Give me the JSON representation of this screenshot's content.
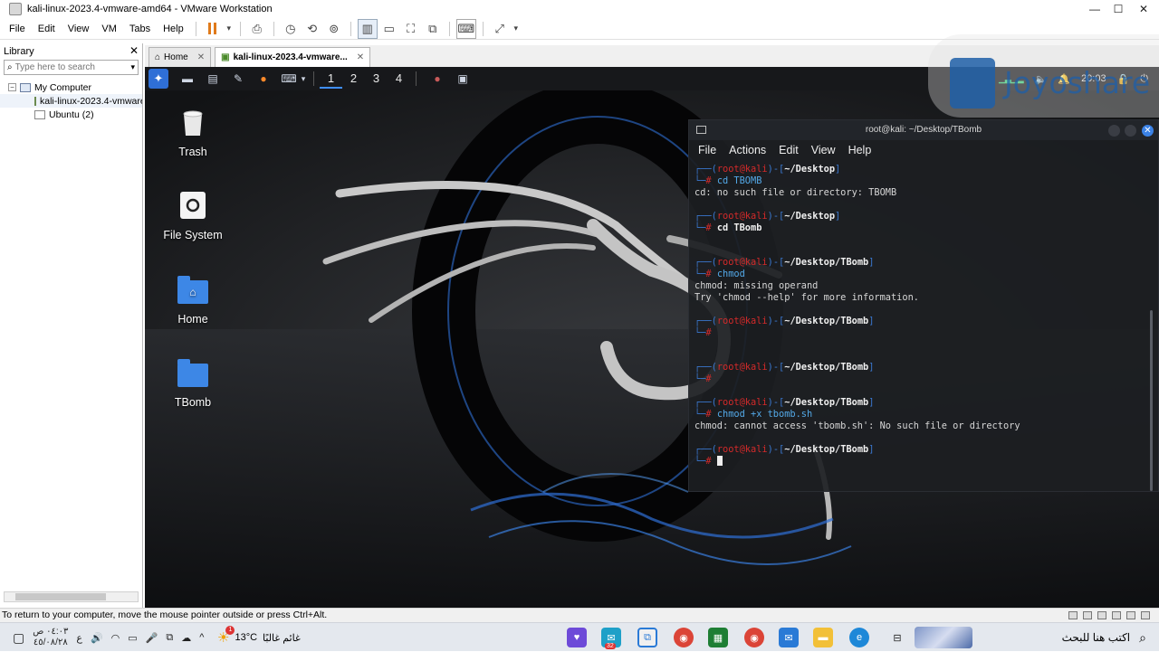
{
  "window": {
    "title": "kali-linux-2023.4-vmware-amd64 - VMware Workstation",
    "minimize_glyph": "—",
    "maximize_glyph": "☐",
    "close_glyph": "✕"
  },
  "menubar": {
    "items": [
      "File",
      "Edit",
      "View",
      "VM",
      "Tabs",
      "Help"
    ]
  },
  "library": {
    "title": "Library",
    "close_glyph": "✕",
    "search_placeholder": "Type here to search",
    "dropdown_glyph": "▾",
    "tree": {
      "root": "My Computer",
      "children": [
        "kali-linux-2023.4-vmware",
        "Ubuntu (2)"
      ]
    }
  },
  "tabs": [
    {
      "label": "Home",
      "active": false
    },
    {
      "label": "kali-linux-2023.4-vmware...",
      "active": true
    }
  ],
  "tab_close_glyph": "✕",
  "guest": {
    "workspaces": [
      "1",
      "2",
      "3",
      "4"
    ],
    "active_workspace": "1",
    "clock": "20:03",
    "desktop_icons": [
      "Trash",
      "File System",
      "Home",
      "TBomb"
    ]
  },
  "terminal": {
    "title": "root@kali: ~/Desktop/TBomb",
    "menu": [
      "File",
      "Actions",
      "Edit",
      "View",
      "Help"
    ],
    "close_glyph": "✕",
    "prompt_user": "root",
    "prompt_at": "@",
    "prompt_host": "kali",
    "lines": [
      {
        "type": "prompt",
        "cwd": "~/Desktop"
      },
      {
        "type": "cmd",
        "text": "cd TBOMB",
        "style": "ok"
      },
      {
        "type": "out",
        "text": "cd: no such file or directory: TBOMB"
      },
      {
        "type": "blank"
      },
      {
        "type": "prompt",
        "cwd": "~/Desktop"
      },
      {
        "type": "cmd",
        "text": "cd TBomb",
        "style": "w"
      },
      {
        "type": "blank"
      },
      {
        "type": "blank"
      },
      {
        "type": "prompt",
        "cwd": "~/Desktop/TBomb"
      },
      {
        "type": "cmd",
        "text": "chmod",
        "style": "ok"
      },
      {
        "type": "out",
        "text": "chmod: missing operand"
      },
      {
        "type": "out",
        "text": "Try 'chmod --help' for more information."
      },
      {
        "type": "blank"
      },
      {
        "type": "prompt",
        "cwd": "~/Desktop/TBomb"
      },
      {
        "type": "cmd",
        "text": "",
        "style": "ok"
      },
      {
        "type": "blank"
      },
      {
        "type": "blank"
      },
      {
        "type": "prompt",
        "cwd": "~/Desktop/TBomb"
      },
      {
        "type": "cmd",
        "text": "",
        "style": "ok"
      },
      {
        "type": "blank"
      },
      {
        "type": "prompt",
        "cwd": "~/Desktop/TBomb"
      },
      {
        "type": "cmd",
        "text": "chmod +x tbomb.sh",
        "style": "ok"
      },
      {
        "type": "out",
        "text": "chmod: cannot access 'tbomb.sh': No such file or directory"
      },
      {
        "type": "blank"
      },
      {
        "type": "prompt",
        "cwd": "~/Desktop/TBomb"
      },
      {
        "type": "cursor"
      }
    ]
  },
  "watermark": {
    "text": "Joyoshare"
  },
  "status_hint": "To return to your computer, move the mouse pointer outside or press Ctrl+Alt.",
  "taskbar": {
    "clock_time": "٠٤:٠٣ ص",
    "clock_date": "٤٥/٠٨/٢٨",
    "lang": "ع",
    "temperature": "13°C",
    "weather_text": "غائم غالبًا",
    "weather_badge": "1",
    "search_text": "اكتب هنا للبحث",
    "mail_badge": "32"
  },
  "colors": {
    "accent_blue": "#3b82e6",
    "prompt_red": "#d42a2a",
    "prompt_blue": "#3a78d0",
    "pause_orange": "#e07a1a"
  }
}
